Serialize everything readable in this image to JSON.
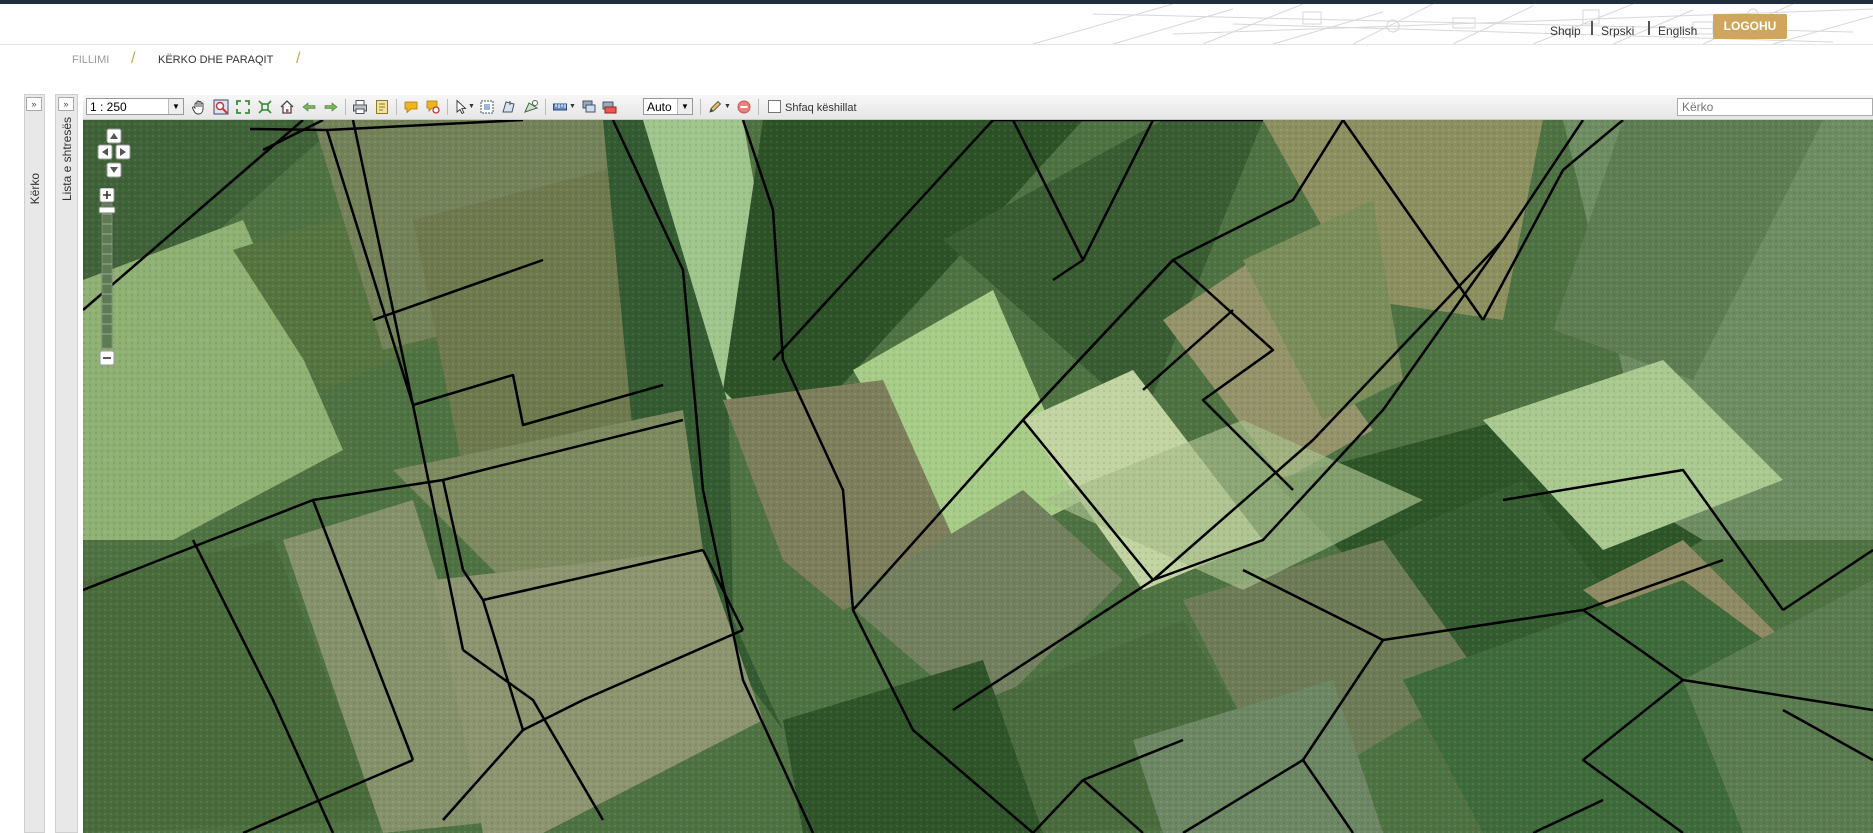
{
  "languages": [
    "Shqip",
    "Srpski",
    "English"
  ],
  "login_label": "LOGOHU",
  "breadcrumb": {
    "home": "FILLIMI",
    "current": "KËRKO DHE PARAQIT"
  },
  "side_tabs": {
    "search": "Kërko",
    "layers": "Lista e shtresës"
  },
  "toolbar": {
    "scale_value": "1 : 250",
    "output_value": "Auto",
    "show_tips_label": "Shfaq këshillat",
    "search_placeholder": "Kërko"
  },
  "colors": {
    "accent": "#d0a55d",
    "top_strip": "#1f2e3a",
    "parcel_line": "#000000"
  },
  "icons": {
    "pan": "hand-icon",
    "zoom_box": "zoom-box-icon",
    "full_extent": "full-extent-icon",
    "home": "home-icon",
    "back": "arrow-left-icon",
    "forward": "arrow-right-icon",
    "print": "print-icon",
    "export": "export-icon",
    "info": "speech-bubble-icon",
    "select": "cursor-icon",
    "draw": "pencil-icon",
    "delete": "delete-icon"
  }
}
